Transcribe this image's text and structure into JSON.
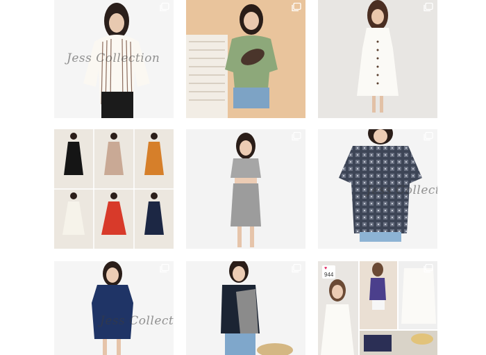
{
  "grid": {
    "tiles": [
      {
        "id": 1,
        "description_icon": "multi-post-icon",
        "watermark": "Jess Collection"
      },
      {
        "id": 2,
        "description_icon": "multi-post-icon",
        "watermark": ""
      },
      {
        "id": 3,
        "description_icon": "multi-post-icon",
        "watermark": ""
      },
      {
        "id": 4,
        "description_icon": "",
        "watermark": ""
      },
      {
        "id": 5,
        "description_icon": "multi-post-icon",
        "watermark": ""
      },
      {
        "id": 6,
        "description_icon": "multi-post-icon",
        "watermark": "Jess Collection"
      },
      {
        "id": 7,
        "description_icon": "multi-post-icon",
        "watermark": "Jess Collection"
      },
      {
        "id": 8,
        "description_icon": "multi-post-icon",
        "watermark": ""
      },
      {
        "id": 9,
        "description_icon": "multi-post-icon",
        "watermark": "",
        "likes": "944"
      }
    ]
  },
  "colors": {
    "background": "#ffffff",
    "icon": "#ffffff"
  }
}
